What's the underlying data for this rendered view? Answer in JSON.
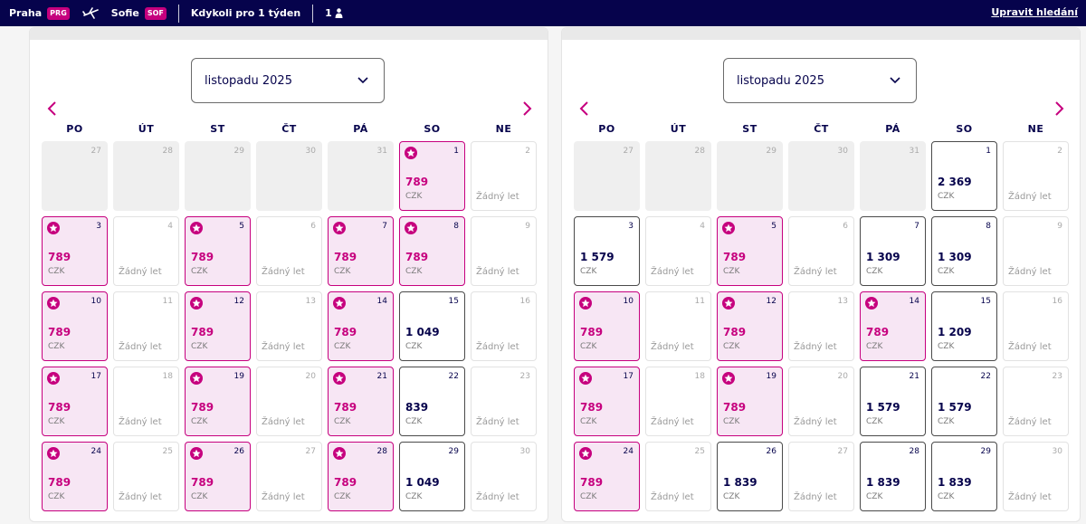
{
  "topbar": {
    "from_city": "Praha",
    "from_code": "PRG",
    "to_city": "Sofie",
    "to_code": "SOF",
    "date_text": "Kdykoli pro 1 týden",
    "passengers": "1",
    "edit_label": "Upravit hledání"
  },
  "weekdays": [
    "PO",
    "ÚT",
    "ST",
    "ČT",
    "PÁ",
    "SO",
    "NE"
  ],
  "labels": {
    "currency": "CZK",
    "no_flight": "Žádný let"
  },
  "colors": {
    "brand_pink": "#c6007e",
    "navy": "#06034c"
  },
  "calendars": [
    {
      "month_label": "listopadu 2025",
      "days": [
        {
          "d": "27",
          "s": "dim"
        },
        {
          "d": "28",
          "s": "dim"
        },
        {
          "d": "29",
          "s": "dim"
        },
        {
          "d": "30",
          "s": "dim"
        },
        {
          "d": "31",
          "s": "dim"
        },
        {
          "d": "1",
          "s": "promo",
          "p": "789"
        },
        {
          "d": "2",
          "s": "none"
        },
        {
          "d": "3",
          "s": "promo",
          "p": "789"
        },
        {
          "d": "4",
          "s": "none"
        },
        {
          "d": "5",
          "s": "promo",
          "p": "789"
        },
        {
          "d": "6",
          "s": "none"
        },
        {
          "d": "7",
          "s": "promo",
          "p": "789"
        },
        {
          "d": "8",
          "s": "promo",
          "p": "789"
        },
        {
          "d": "9",
          "s": "none"
        },
        {
          "d": "10",
          "s": "promo",
          "p": "789"
        },
        {
          "d": "11",
          "s": "none"
        },
        {
          "d": "12",
          "s": "promo",
          "p": "789"
        },
        {
          "d": "13",
          "s": "none"
        },
        {
          "d": "14",
          "s": "promo",
          "p": "789"
        },
        {
          "d": "15",
          "s": "priced",
          "p": "1 049"
        },
        {
          "d": "16",
          "s": "none"
        },
        {
          "d": "17",
          "s": "promo",
          "p": "789"
        },
        {
          "d": "18",
          "s": "none"
        },
        {
          "d": "19",
          "s": "promo",
          "p": "789"
        },
        {
          "d": "20",
          "s": "none"
        },
        {
          "d": "21",
          "s": "promo",
          "p": "789"
        },
        {
          "d": "22",
          "s": "priced",
          "p": "839"
        },
        {
          "d": "23",
          "s": "none"
        },
        {
          "d": "24",
          "s": "promo",
          "p": "789"
        },
        {
          "d": "25",
          "s": "none"
        },
        {
          "d": "26",
          "s": "promo",
          "p": "789"
        },
        {
          "d": "27",
          "s": "none"
        },
        {
          "d": "28",
          "s": "promo",
          "p": "789"
        },
        {
          "d": "29",
          "s": "priced",
          "p": "1 049"
        },
        {
          "d": "30",
          "s": "none"
        }
      ]
    },
    {
      "month_label": "listopadu 2025",
      "days": [
        {
          "d": "27",
          "s": "dim"
        },
        {
          "d": "28",
          "s": "dim"
        },
        {
          "d": "29",
          "s": "dim"
        },
        {
          "d": "30",
          "s": "dim"
        },
        {
          "d": "31",
          "s": "dim"
        },
        {
          "d": "1",
          "s": "priced",
          "p": "2 369"
        },
        {
          "d": "2",
          "s": "none"
        },
        {
          "d": "3",
          "s": "priced",
          "p": "1 579"
        },
        {
          "d": "4",
          "s": "none"
        },
        {
          "d": "5",
          "s": "promo",
          "p": "789"
        },
        {
          "d": "6",
          "s": "none"
        },
        {
          "d": "7",
          "s": "priced",
          "p": "1 309"
        },
        {
          "d": "8",
          "s": "priced",
          "p": "1 309"
        },
        {
          "d": "9",
          "s": "none"
        },
        {
          "d": "10",
          "s": "promo",
          "p": "789"
        },
        {
          "d": "11",
          "s": "none"
        },
        {
          "d": "12",
          "s": "promo",
          "p": "789"
        },
        {
          "d": "13",
          "s": "none"
        },
        {
          "d": "14",
          "s": "promo",
          "p": "789"
        },
        {
          "d": "15",
          "s": "priced",
          "p": "1 209"
        },
        {
          "d": "16",
          "s": "none"
        },
        {
          "d": "17",
          "s": "promo",
          "p": "789"
        },
        {
          "d": "18",
          "s": "none"
        },
        {
          "d": "19",
          "s": "promo",
          "p": "789"
        },
        {
          "d": "20",
          "s": "none"
        },
        {
          "d": "21",
          "s": "priced",
          "p": "1 579"
        },
        {
          "d": "22",
          "s": "priced",
          "p": "1 579"
        },
        {
          "d": "23",
          "s": "none"
        },
        {
          "d": "24",
          "s": "promo",
          "p": "789"
        },
        {
          "d": "25",
          "s": "none"
        },
        {
          "d": "26",
          "s": "priced",
          "p": "1 839"
        },
        {
          "d": "27",
          "s": "none"
        },
        {
          "d": "28",
          "s": "priced",
          "p": "1 839"
        },
        {
          "d": "29",
          "s": "priced",
          "p": "1 839"
        },
        {
          "d": "30",
          "s": "none"
        }
      ]
    }
  ]
}
